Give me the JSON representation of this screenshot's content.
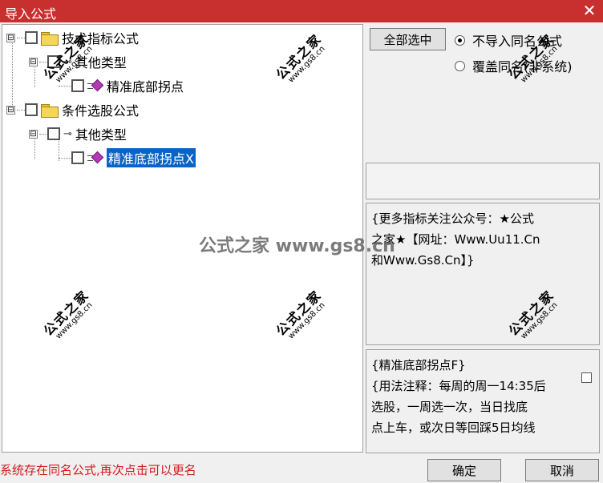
{
  "window": {
    "title": "导入公式",
    "close_glyph": "✕"
  },
  "tree": {
    "nodes": [
      {
        "label": "技术指标公式",
        "expander": "⊟"
      },
      {
        "label": "其他类型",
        "expander": "⊟"
      },
      {
        "label": "精准底部拐点"
      },
      {
        "label": "条件选股公式",
        "expander": "⊟"
      },
      {
        "label": "其他类型",
        "expander": "⊟"
      },
      {
        "label": "精准底部拐点X",
        "selected": true
      }
    ],
    "icons": {
      "folder": "folder-icon",
      "key": "key-icon",
      "gem": "formula-gem-icon"
    }
  },
  "options": {
    "select_all_label": "全部选中",
    "radio_no_import": "不导入同名公式",
    "radio_overwrite": "覆盖同名(非系统)",
    "selected_radio": "不导入同名公式"
  },
  "info": {
    "notice": "{更多指标关注公众号：★公式\n之家★【网址：Www.Uu11.Cn\n和Www.Gs8.Cn】}",
    "detail": "{精准底部拐点F}\n{用法注释：每周的周一14:35后\n选股，一周选一次，当日找底\n点上车，或次日等回踩5日均线"
  },
  "status": {
    "message": "系统存在同名公式,再次点击可以更名"
  },
  "footer": {
    "ok_label": "确定",
    "cancel_label": "取消"
  },
  "watermark": {
    "big": "公式之家 www.gs8.cn",
    "small_top": "公式之家",
    "small_bottom": "www.gs8.cn"
  },
  "colors": {
    "title_bar": "#c8302f",
    "selection": "#0a64c8",
    "status_text": "#d21b1b"
  }
}
